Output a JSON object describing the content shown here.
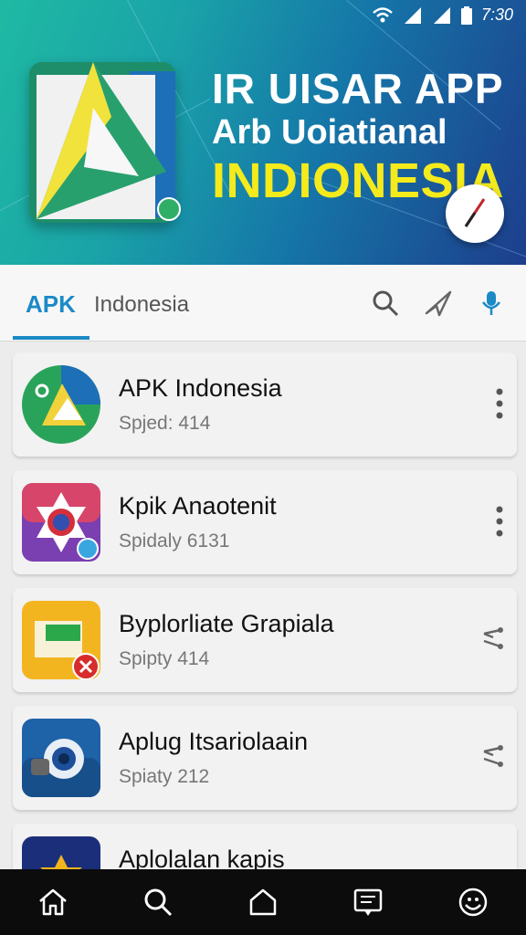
{
  "status_bar": {
    "time": "7:30"
  },
  "banner": {
    "title_line1": "IR UISAR APP",
    "title_line2": "Arb Uoiatianal",
    "title_line3": "INDIONESIA"
  },
  "tabs": {
    "active_label": "APK",
    "second_label": "Indonesia"
  },
  "apps": [
    {
      "name": "APK Indonesia",
      "sub": "Spjed: 414",
      "action_icon": "more-vert-icon"
    },
    {
      "name": "Kpik Anaotenit",
      "sub": "Spidaly 6131",
      "action_icon": "more-vert-icon"
    },
    {
      "name": "Byplorliate Grapiala",
      "sub": "Spipty 414",
      "action_icon": "share-icon"
    },
    {
      "name": "Aplug Itsariolaain",
      "sub": "Spiaty 212",
      "action_icon": "share-icon"
    },
    {
      "name": "Aplolalan kapis",
      "sub": "",
      "action_icon": "more-vert-icon"
    }
  ],
  "colors": {
    "accent": "#1b8ac7",
    "title_yellow": "#f4ea1c",
    "nav_bg": "#0c0c0c"
  }
}
